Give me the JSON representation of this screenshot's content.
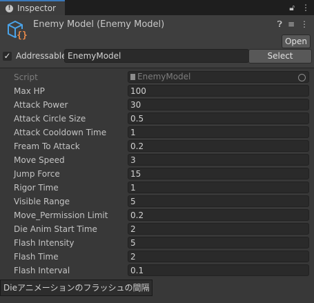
{
  "tab": {
    "title": "Inspector",
    "lock_icon": "lock-icon",
    "menu_icon": "kebab-menu-icon"
  },
  "header": {
    "title": "Enemy Model (Enemy Model)",
    "open_label": "Open",
    "help_icon": "help-icon",
    "settings_icon": "preset-sliders-icon",
    "menu_icon": "kebab-menu-icon"
  },
  "addressable": {
    "label": "Addressable",
    "checked": true,
    "value": "EnemyModel",
    "select_label": "Select"
  },
  "script_field": {
    "label": "Script",
    "value": "EnemyModel"
  },
  "properties": [
    {
      "label": "Max HP",
      "value": "100"
    },
    {
      "label": "Attack Power",
      "value": "30"
    },
    {
      "label": "Attack Circle Size",
      "value": "0.5"
    },
    {
      "label": "Attack Cooldown Time",
      "value": "1"
    },
    {
      "label": "Fream To Attack",
      "value": "0.2"
    },
    {
      "label": "Move Speed",
      "value": "3"
    },
    {
      "label": "Jump Force",
      "value": "15"
    },
    {
      "label": "Rigor Time",
      "value": "1"
    },
    {
      "label": "Visible Range",
      "value": "5"
    },
    {
      "label": "Move_Permission Limit",
      "value": "0.2"
    },
    {
      "label": "Die Anim Start Time",
      "value": "2"
    },
    {
      "label": "Flash Intensity",
      "value": "5"
    },
    {
      "label": "Flash Time",
      "value": "2"
    },
    {
      "label": "Flash Interval",
      "value": "0.1"
    }
  ],
  "tooltip": "Dieアニメーションのフラッシュの間隔",
  "colors": {
    "accent": "#3a79bb",
    "background": "#383838",
    "field": "#2a2a2a"
  }
}
